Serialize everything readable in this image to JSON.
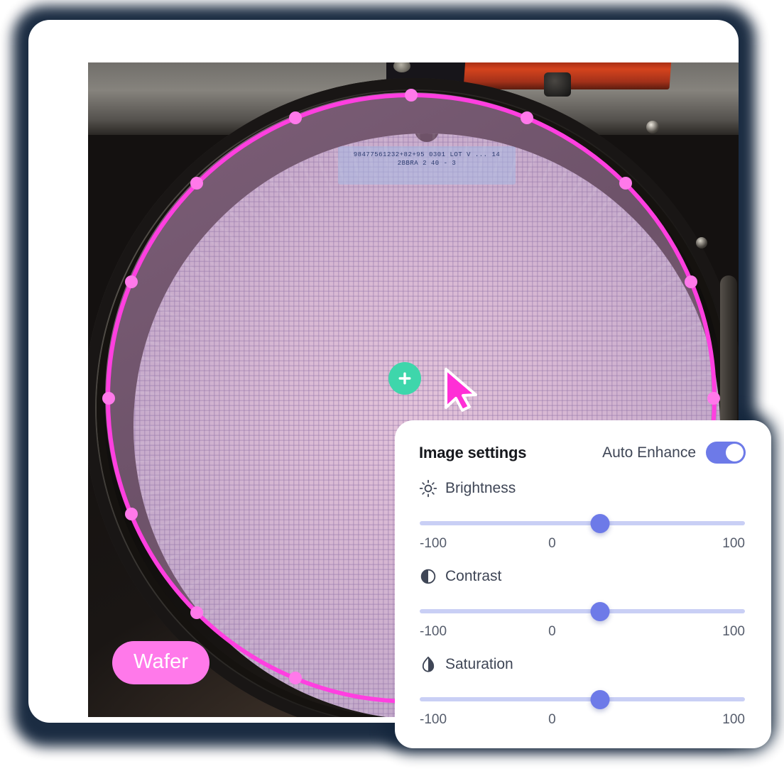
{
  "viewer": {
    "label_badge": "Wafer",
    "add_point_icon": "plus-icon",
    "cursor_icon": "cursor-arrow-icon",
    "wafer_inscription": "98477561232+82+95  0301 LOT V ... 14  2BBRA 2 40 - 3",
    "annotation": {
      "shape": "circle",
      "stroke_color": "#ff3fe0",
      "handle_color": "#ff79ea",
      "handle_count": 16
    }
  },
  "settings_panel": {
    "title": "Image settings",
    "auto_enhance": {
      "label": "Auto Enhance",
      "enabled": true,
      "on_color": "#6d7ae8"
    },
    "accent_color": "#6d7ae8",
    "track_color": "#c9cff5",
    "controls": [
      {
        "name": "brightness",
        "label": "Brightness",
        "icon": "sun-icon",
        "value": 11,
        "min_label": "-100",
        "mid_label": "0",
        "max_label": "100",
        "min": -100,
        "max": 100
      },
      {
        "name": "contrast",
        "label": "Contrast",
        "icon": "contrast-circle-icon",
        "value": 11,
        "min_label": "-100",
        "mid_label": "0",
        "max_label": "100",
        "min": -100,
        "max": 100
      },
      {
        "name": "saturation",
        "label": "Saturation",
        "icon": "droplet-icon",
        "value": 11,
        "min_label": "-100",
        "mid_label": "0",
        "max_label": "100",
        "min": -100,
        "max": 100
      }
    ]
  }
}
